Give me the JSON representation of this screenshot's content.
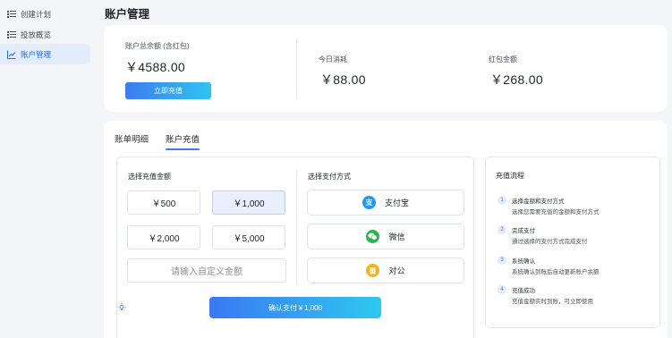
{
  "sidebar": {
    "items": [
      {
        "label": "创建计划",
        "icon": "list-icon"
      },
      {
        "label": "投放概览",
        "icon": "list-icon"
      },
      {
        "label": "账户管理",
        "icon": "chart-line-icon",
        "active": true
      }
    ]
  },
  "page": {
    "title": "账户管理"
  },
  "summary": {
    "balance_label": "账户总余额 (含红包)",
    "balance_value": "￥4588.00",
    "recharge_button": "立即充值",
    "today_label": "今日消耗",
    "today_value": "￥88.00",
    "redpacket_label": "红包金额",
    "redpacket_value": "￥268.00"
  },
  "tabs": [
    {
      "label": "账单明细",
      "active": false
    },
    {
      "label": "账户充值",
      "active": true
    }
  ],
  "recharge": {
    "amount_label": "选择充值金额",
    "amounts": [
      "￥500",
      "￥1,000",
      "￥2,000",
      "￥5,000"
    ],
    "selected_amount": "￥1,000",
    "custom_placeholder": "请输入自定义金额",
    "pay_label": "选择支付方式",
    "pay_methods": [
      {
        "label": "支付宝",
        "icon": "alipay-icon",
        "color": "#1a9bf0"
      },
      {
        "label": "微信",
        "icon": "wechat-icon",
        "color": "#22b84b"
      },
      {
        "label": "对公",
        "icon": "building-icon",
        "color": "#f7b21a"
      }
    ],
    "confirm_button": "确认支付￥1,000"
  },
  "flow": {
    "title": "充值流程",
    "steps": [
      {
        "num": "1",
        "title": "选择金额和支付方式",
        "desc": "选择您需要充值的金额和支付方式"
      },
      {
        "num": "2",
        "title": "完成支付",
        "desc": "通过选择的支付方式完成支付"
      },
      {
        "num": "3",
        "title": "系统确认",
        "desc": "系统确认到账后自动更新账户余额"
      },
      {
        "num": "4",
        "title": "充值成功",
        "desc": "充值金额实时到账，可立即使用"
      }
    ]
  },
  "colors": {
    "accent": "#3a7cf3",
    "accent_light": "#e3ecfb",
    "background": "#f3f5f8"
  }
}
